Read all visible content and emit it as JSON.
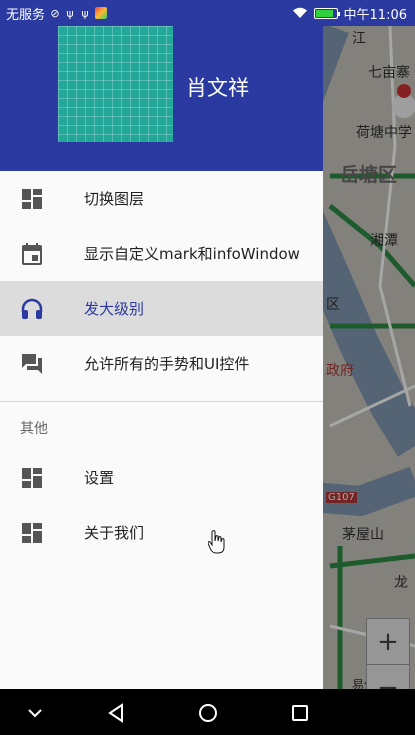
{
  "status_bar": {
    "carrier": "无服务",
    "time": "中午11:06",
    "battery_level": 0.85
  },
  "drawer": {
    "header": {
      "username": "肖文祥"
    },
    "items": [
      {
        "label": "切换图层",
        "icon": "dashboard-icon",
        "active": false
      },
      {
        "label": "显示自定义mark和infoWindow",
        "icon": "calendar-icon",
        "active": false
      },
      {
        "label": "发大级别",
        "icon": "headphones-icon",
        "active": true
      },
      {
        "label": "允许所有的手势和UI控件",
        "icon": "forum-icon",
        "active": false
      }
    ],
    "other_section_title": "其他",
    "other_items": [
      {
        "label": "设置",
        "icon": "dashboard-icon"
      },
      {
        "label": "关于我们",
        "icon": "dashboard-icon"
      }
    ]
  },
  "map": {
    "labels": [
      "江",
      "七亩寨",
      "荷塘中学",
      "岳塘区",
      "湘潭",
      "区",
      "政府",
      "G107",
      "茅屋山",
      "龙",
      "易俗河镇"
    ],
    "zoom_in": "+",
    "zoom_out": "−"
  },
  "colors": {
    "primary": "#2b3aa0",
    "avatar": "#22a799",
    "active_bg": "#dcdcdc"
  }
}
